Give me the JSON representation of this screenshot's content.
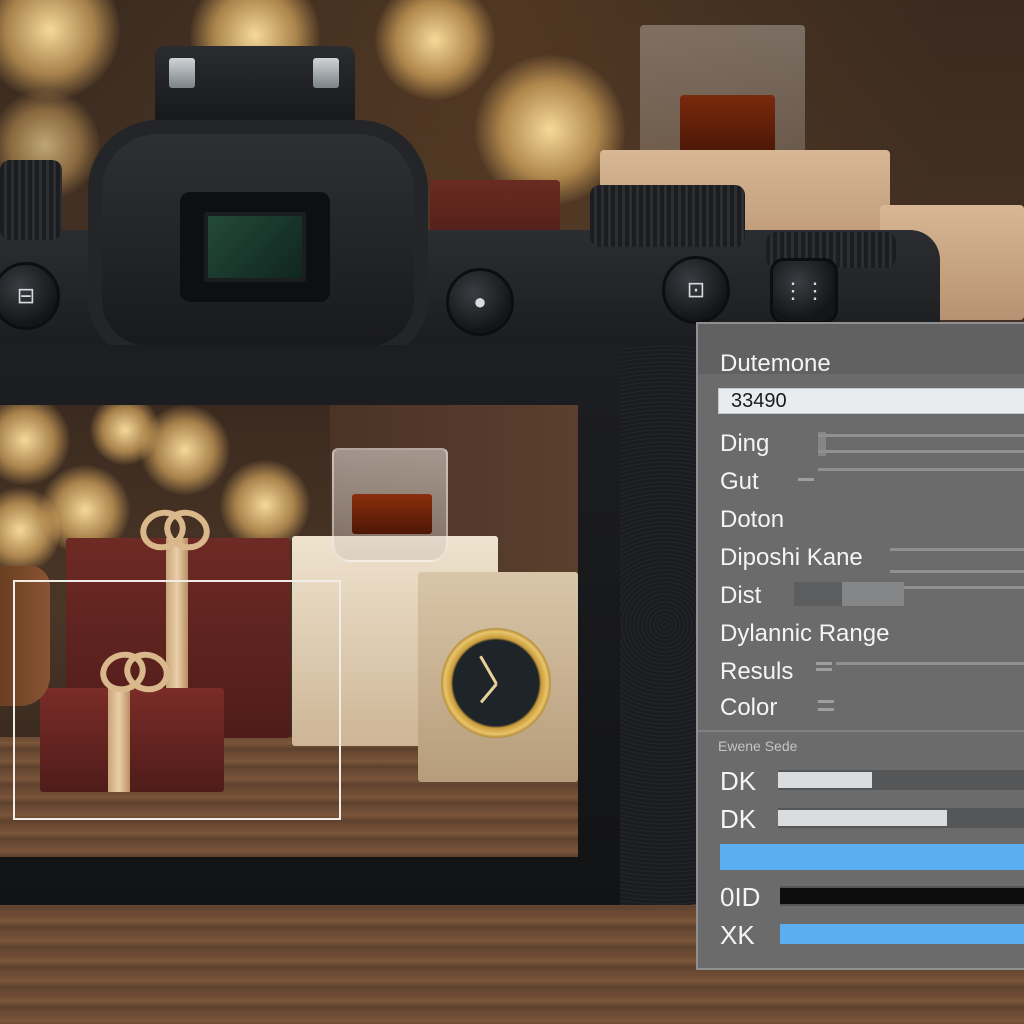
{
  "panel": {
    "title": "Dutemone",
    "value_field": "33490",
    "rows": [
      {
        "label": "Ding"
      },
      {
        "label": "Gut"
      },
      {
        "label": "Doton"
      },
      {
        "label": "Diposhi Kane"
      },
      {
        "label": "Dist"
      },
      {
        "label": "Dylannic Range"
      },
      {
        "label": "Resuls"
      },
      {
        "label": "Color"
      }
    ],
    "section_title": "Ewene Sede",
    "sliders": [
      {
        "label": "DK",
        "level": 0.38,
        "style": "light"
      },
      {
        "label": "DK",
        "level": 0.68,
        "style": "light"
      },
      {
        "label": "",
        "level": 1.0,
        "style": "blue"
      },
      {
        "label": "0ID",
        "level": 1.0,
        "style": "black"
      },
      {
        "label": "XK",
        "level": 1.0,
        "style": "blue"
      }
    ]
  },
  "camera": {
    "left_button_icon": "mode-icon",
    "center_button_icon": "shutter-small-icon",
    "right_button_icon": "function-icon",
    "switch_icon": "switch-icon"
  },
  "colors": {
    "panel_bg": "#6b6b6c",
    "accent_blue": "#5baef0",
    "field_bg": "#e9ecee"
  }
}
